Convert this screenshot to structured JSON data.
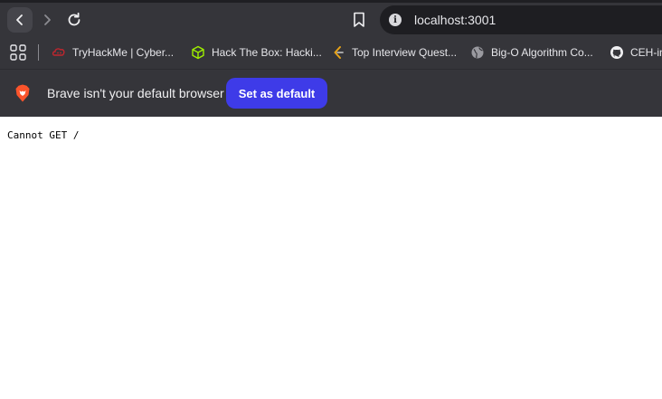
{
  "toolbar": {
    "url": "localhost:3001"
  },
  "bookmarks": [
    {
      "label": "TryHackMe | Cyber...",
      "icon": "tryhackme-icon"
    },
    {
      "label": "Hack The Box: Hacki...",
      "icon": "hackthebox-icon"
    },
    {
      "label": "Top Interview Quest...",
      "icon": "leetcode-icon"
    },
    {
      "label": "Big-O Algorithm Co...",
      "icon": "globe-icon"
    },
    {
      "label": "CEH-in",
      "icon": "github-icon"
    }
  ],
  "infobar": {
    "message": "Brave isn't your default browser",
    "button_label": "Set as default"
  },
  "page": {
    "content": "Cannot GET /"
  },
  "colors": {
    "accent_button": "#3e3be8",
    "chrome_background": "#35353a"
  }
}
